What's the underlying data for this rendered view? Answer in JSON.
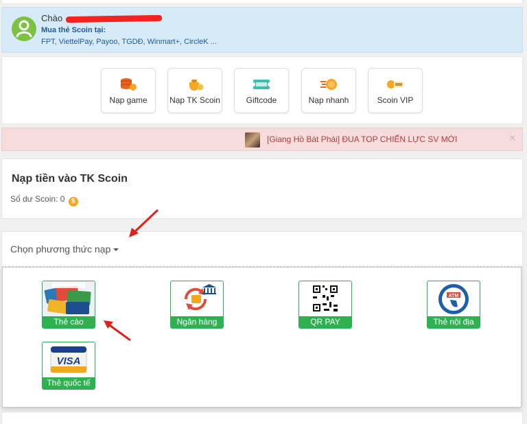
{
  "greeting": {
    "hello": "Chào",
    "buy_title": "Mua thẻ Scoin tại:",
    "places": "FPT, ViettelPay, Payoo, TGDĐ, Winmart+, CircleK ..."
  },
  "actions": [
    {
      "label": "Nạp game",
      "icon": "coin-stack-icon"
    },
    {
      "label": "Nạp TK Scoin",
      "icon": "coin-bag-icon"
    },
    {
      "label": "Giftcode",
      "icon": "ticket-icon"
    },
    {
      "label": "Nạp nhanh",
      "icon": "fast-coin-icon"
    },
    {
      "label": "Scoin VIP",
      "icon": "scoin-vip-icon"
    }
  ],
  "notice": {
    "text": "[Giang Hồ Bát Phái] ĐUA TOP CHIẾN LỰC SV MỚI",
    "close": "×"
  },
  "balance": {
    "title": "Nạp tiền vào TK Scoin",
    "label": "Số dư Scoin: 0"
  },
  "method": {
    "label": "Chọn phương thức nạp"
  },
  "payment_methods": [
    {
      "label": "Thẻ cào",
      "icon": "scratch-card-icon"
    },
    {
      "label": "Ngân hàng",
      "icon": "bank-transfer-icon"
    },
    {
      "label": "QR PAY",
      "icon": "qr-code-icon"
    },
    {
      "label": "Thẻ nội địa",
      "icon": "atm-card-icon"
    },
    {
      "label": "Thẻ quốc tế",
      "icon": "visa-card-icon"
    }
  ],
  "colors": {
    "accent_green": "#2fb14f",
    "greeting_bg": "#d6eaf8",
    "notice_bg": "#f6dcdc",
    "arrow_red": "#e0201b"
  }
}
